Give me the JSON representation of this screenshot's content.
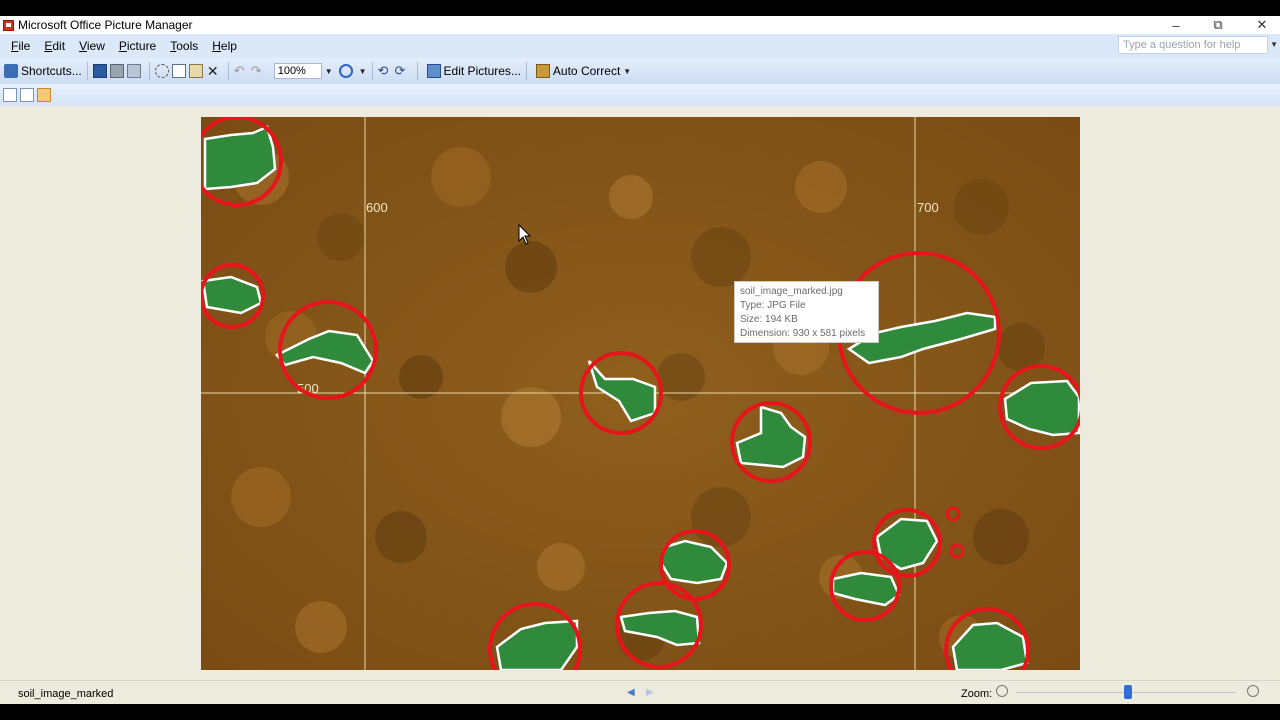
{
  "window": {
    "title": "Microsoft Office Picture Manager",
    "controls": [
      "–",
      "⧉",
      "✕"
    ]
  },
  "menu": {
    "items": [
      {
        "acc": "F",
        "rest": "ile"
      },
      {
        "acc": "E",
        "rest": "dit"
      },
      {
        "acc": "V",
        "rest": "iew"
      },
      {
        "acc": "P",
        "rest": "icture"
      },
      {
        "acc": "T",
        "rest": "ools"
      },
      {
        "acc": "H",
        "rest": "elp"
      }
    ],
    "help_placeholder": "Type a question for help"
  },
  "toolbar": {
    "shortcuts_label": "Shortcuts...",
    "zoom_value": "100%",
    "edit_pictures_label": "Edit Pictures...",
    "auto_correct_label": "Auto Correct"
  },
  "picture": {
    "grid_labels": {
      "x600": "600",
      "x700": "700",
      "y500": "500"
    },
    "tooltip": {
      "name": "soil_image_marked.jpg",
      "type": "Type: JPG File",
      "size": "Size: 194 KB",
      "dimension": "Dimension: 930 x 581 pixels"
    },
    "colors": {
      "soil": "#8c5d1c",
      "vegetation": "#2f8a3c",
      "marker": "#e8141b",
      "outline": "#ffffff"
    }
  },
  "status": {
    "filename": "soil_image_marked",
    "zoom_label": "Zoom:"
  }
}
